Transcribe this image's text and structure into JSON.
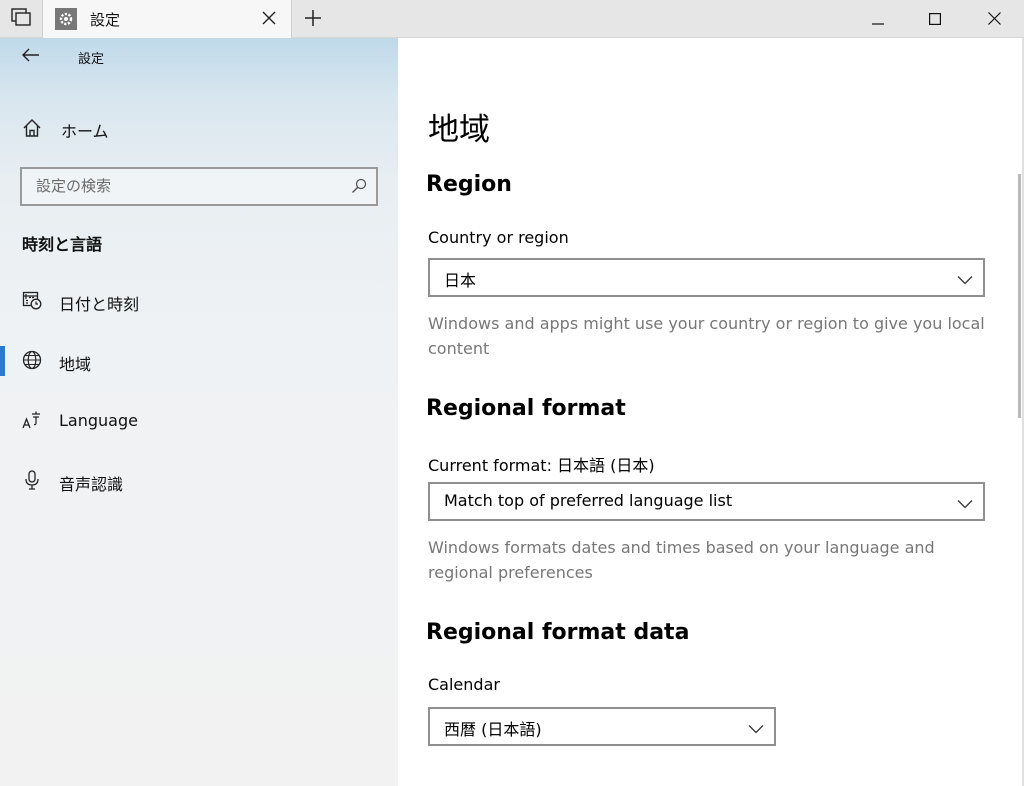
{
  "window": {
    "tab_title": "設定",
    "icons": [
      "tab-sets-icon",
      "gear-icon",
      "close-icon",
      "plus-icon",
      "minimize-icon",
      "maximize-icon",
      "close-icon"
    ]
  },
  "sidebar": {
    "title": "設定",
    "home_label": "ホーム",
    "search_placeholder": "設定の検索",
    "section_title": "時刻と言語",
    "items": [
      {
        "label": "日付と時刻",
        "icon": "calendar-clock-icon",
        "selected": false
      },
      {
        "label": "地域",
        "icon": "globe-icon",
        "selected": true
      },
      {
        "label": "Language",
        "icon": "language-icon",
        "selected": false
      },
      {
        "label": "音声認識",
        "icon": "microphone-icon",
        "selected": false
      }
    ],
    "accent": "#2b79d0"
  },
  "main": {
    "title": "地域",
    "region": {
      "heading": "Region",
      "country_label": "Country or region",
      "country_value": "日本",
      "country_desc": "Windows and apps might use your country or region to give you local content"
    },
    "format": {
      "heading": "Regional format",
      "current_label": "Current format: 日本語 (日本)",
      "format_value": "Match top of preferred language list",
      "format_desc": "Windows formats dates and times based on your language and regional preferences"
    },
    "format_data": {
      "heading": "Regional format data",
      "calendar_label": "Calendar",
      "calendar_value": "西暦 (日本語)"
    }
  }
}
